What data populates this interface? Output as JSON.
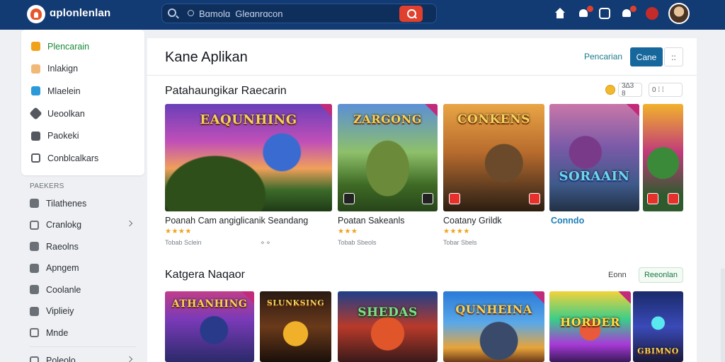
{
  "header": {
    "brand": "ɑplonlenlan",
    "search_placeholder": "Bɑmolɑ  Gleɑnrɑcon",
    "icons": [
      "home-icon",
      "bell-icon",
      "chat-icon",
      "bell-icon",
      "user-icon",
      "avatar"
    ]
  },
  "sidebar": {
    "primary": [
      {
        "label": "Plencarain",
        "icon": "store-icon",
        "active": true
      },
      {
        "label": "Inlakign",
        "icon": "sparkle-icon"
      },
      {
        "label": "Mlaelein",
        "icon": "tv-icon"
      },
      {
        "label": "Ueoolkan",
        "icon": "tag-icon"
      },
      {
        "label": "Paokeki",
        "icon": "flag-icon"
      },
      {
        "label": "Conblcalkars",
        "icon": "search-icon"
      }
    ],
    "section_label": "PAEKERS",
    "secondary": [
      {
        "label": "Tilathenes",
        "icon": "user-group-icon",
        "chevron": false
      },
      {
        "label": "Cranlokg",
        "icon": "ring-icon",
        "chevron": true
      },
      {
        "label": "Raeolns",
        "icon": "document-icon",
        "chevron": false
      },
      {
        "label": "Apngem",
        "icon": "person-icon",
        "chevron": false
      },
      {
        "label": "Coolanle",
        "icon": "pin-icon",
        "chevron": false
      },
      {
        "label": "Viplieiy",
        "icon": "person-icon",
        "chevron": false
      },
      {
        "label": "Mnde",
        "icon": "eye-icon",
        "chevron": false
      }
    ],
    "footer_item": {
      "label": "Poleolo",
      "icon": "clock-icon",
      "chevron": true
    }
  },
  "main": {
    "title": "Kane Aplikan",
    "actions": {
      "search": "Pencarian",
      "primary": "Cane",
      "more": "::"
    },
    "section1": {
      "title": "Patahaungikar Raecarin",
      "filter_a": "3∆3 8",
      "filter_b": "0 ⁞ ⁞",
      "cards": [
        {
          "thumb_text": "EAQUNHING",
          "title": "Poanah Cam angiglicanik Seandang",
          "stars": "★★★★",
          "meta": "Tobab Sclein"
        },
        {
          "thumb_text": "ZARGONG",
          "title": "Poatan Sakeanls",
          "stars": "★★★",
          "meta": "Tobab Sbeols"
        },
        {
          "thumb_text": "CONKENS",
          "title": "Coatany Grildk",
          "stars": "★★★★",
          "meta": "Tobar Sbels"
        },
        {
          "thumb_text": "SORAAIN",
          "title": "Conndo",
          "stars": "",
          "meta": ""
        },
        {
          "thumb_text": "",
          "title": "",
          "stars": "",
          "meta": ""
        }
      ]
    },
    "section2": {
      "title": "Katgera Naqaor",
      "link": "Eonn",
      "button": "Reeonlan",
      "cards": [
        {
          "thumb_text": "ATHANHING"
        },
        {
          "thumb_text": "SLUNKSING"
        },
        {
          "thumb_text": "SHEDAS"
        },
        {
          "thumb_text": "QUNHEINA"
        },
        {
          "thumb_text": "HORDER"
        },
        {
          "thumb_text": "GBIMNO"
        }
      ]
    }
  },
  "colors": {
    "topbar": "#123a73",
    "accent_green": "#1a8a3a",
    "primary_button": "#16679c",
    "search_button": "#e0402e",
    "link": "#1b7db8"
  }
}
